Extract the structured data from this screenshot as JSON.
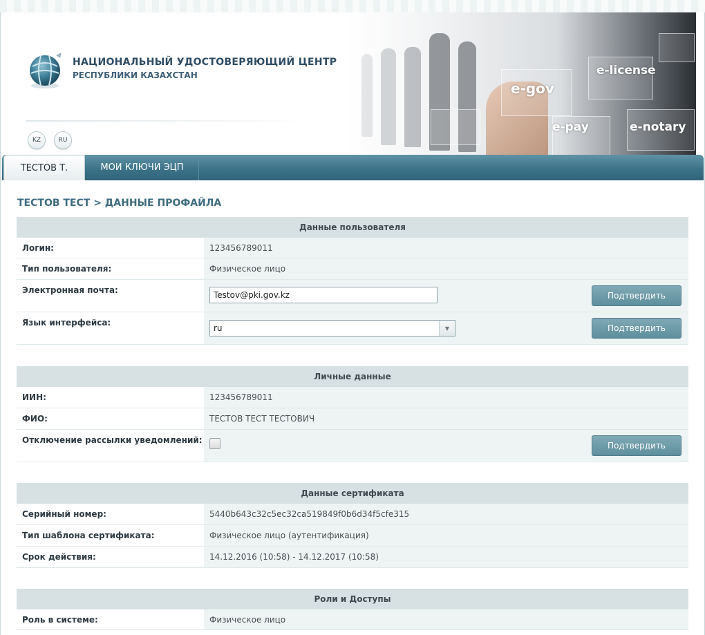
{
  "header": {
    "org_line1": "НАЦИОНАЛЬНЫЙ УДОСТОВЕРЯЮЩИЙ ЦЕНТР",
    "org_line2": "РЕСПУБЛИКИ КАЗАХСТАН",
    "languages": [
      "KZ",
      "RU"
    ],
    "banner_labels": [
      "e-license",
      "e-gov",
      "e-pay",
      "e-notary"
    ]
  },
  "nav": {
    "tabs": [
      "ТЕСТОВ Т.",
      "МОИ КЛЮЧИ ЭЦП"
    ],
    "active_index": 0
  },
  "page": {
    "title": "ТЕСТОВ ТЕСТ > ДАННЫЕ ПРОФАЙЛА"
  },
  "user_data": {
    "heading": "Данные пользователя",
    "login_label": "Логин:",
    "login_value": "123456789011",
    "user_type_label": "Тип пользователя:",
    "user_type_value": "Физическое лицо",
    "email_label": "Электронная почта:",
    "email_value": "Testov@pki.gov.kz",
    "language_label": "Язык интерфейса:",
    "language_value": "ru",
    "confirm_label": "Подтвердить"
  },
  "personal_data": {
    "heading": "Личные данные",
    "iin_label": "ИИН:",
    "iin_value": "123456789011",
    "fio_label": "ФИО:",
    "fio_value": "ТЕСТОВ ТЕСТ ТЕСТОВИЧ",
    "notify_label": "Отключение рассылки уведомлений:",
    "notify_checked": false,
    "confirm_label": "Подтвердить"
  },
  "certificate": {
    "heading": "Данные сертификата",
    "serial_label": "Серийный номер:",
    "serial_value": "5440b643c32c5ec32ca519849f0b6d34f5cfe315",
    "template_label": "Тип шаблона сертификата:",
    "template_value": "Физическое лицо (аутентификация)",
    "validity_label": "Срок действия:",
    "validity_value": "14.12.2016 (10:58) - 14.12.2017 (10:58)"
  },
  "roles": {
    "heading": "Роли и Доступы",
    "role_label": "Роль в системе:",
    "role_value": "Физическое лицо"
  },
  "colors": {
    "nav_bar": "#3d7389",
    "title": "#3d6c80",
    "section_head": "#d7e1e3",
    "value_cell": "#edf4f3",
    "button": "#6e9ba8"
  }
}
